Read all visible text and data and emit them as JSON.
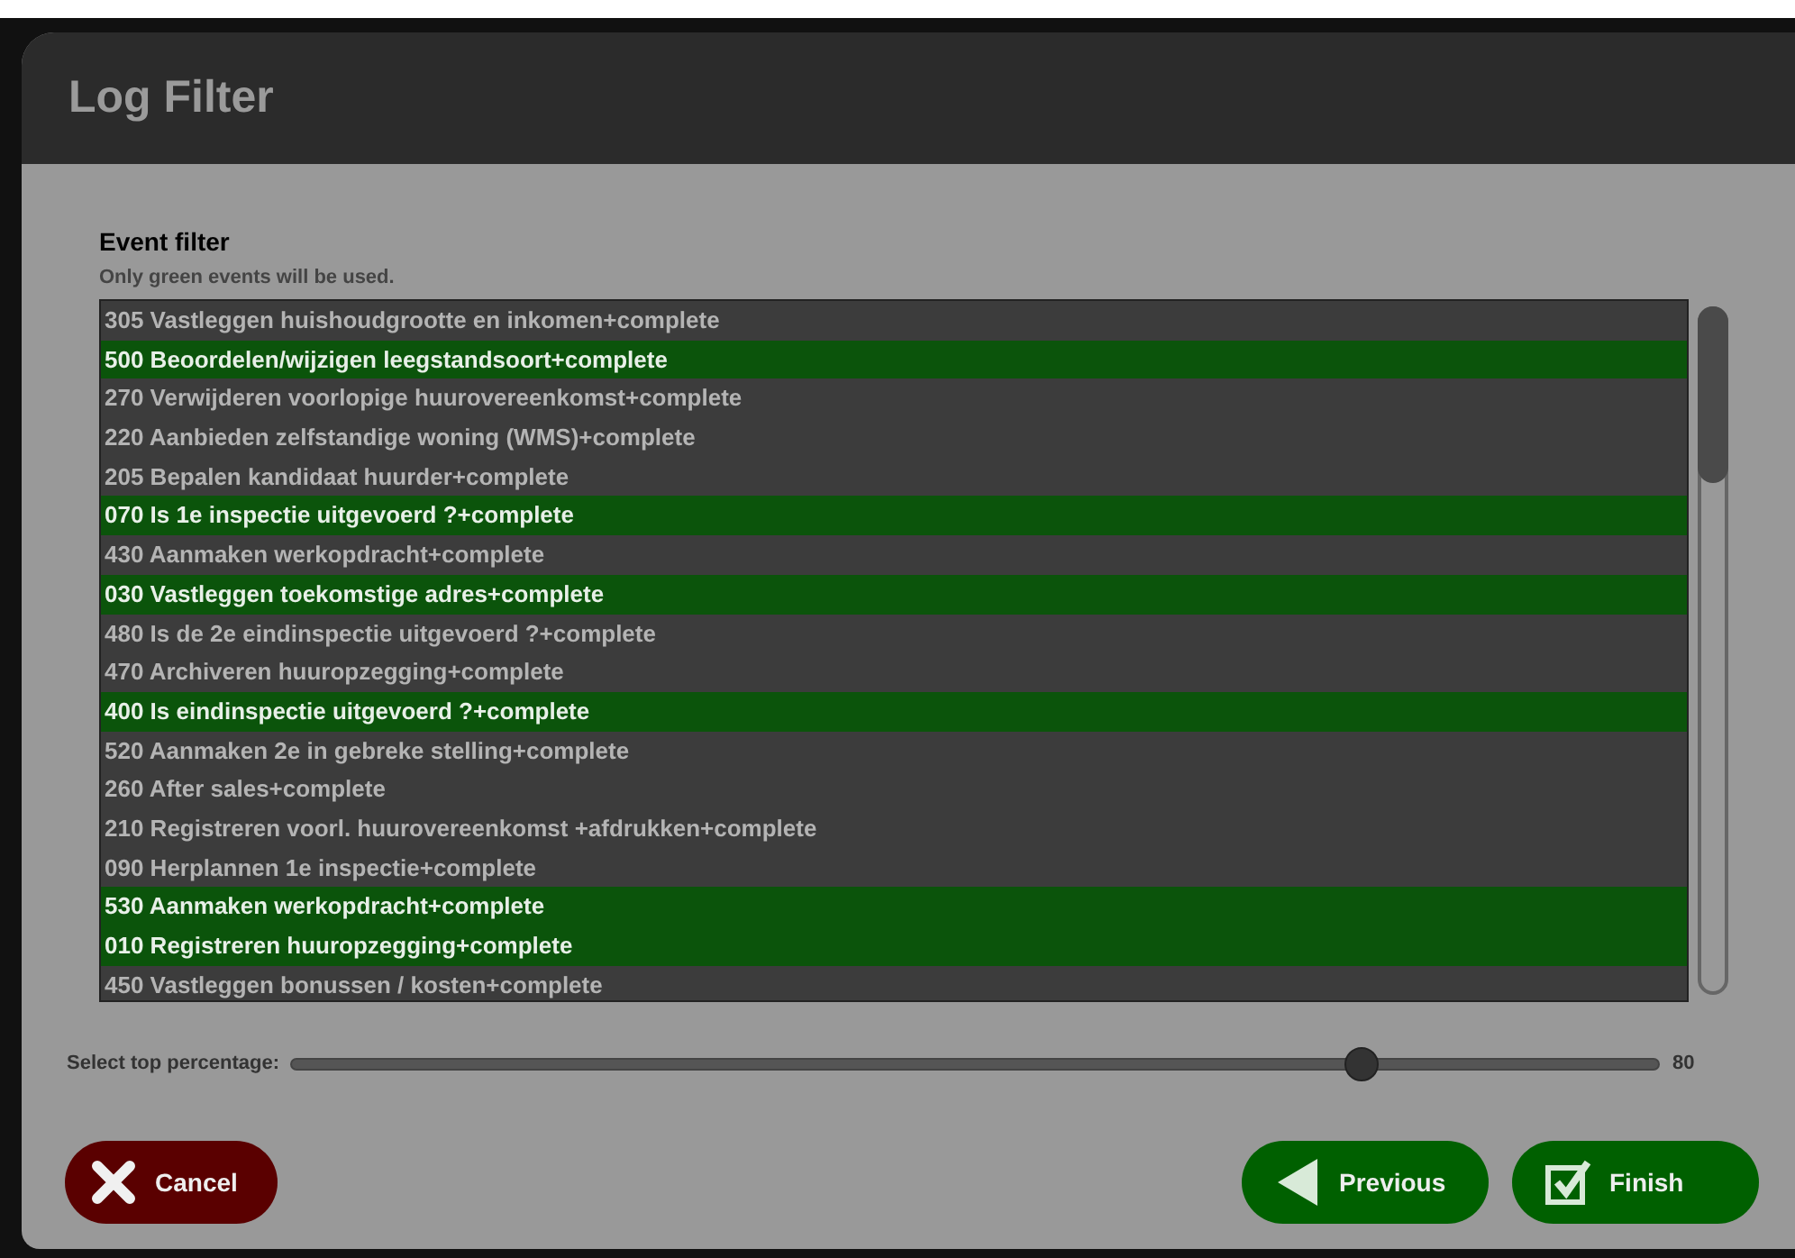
{
  "dialog": {
    "title": "Log Filter"
  },
  "event_filter": {
    "heading": "Event filter",
    "hint": "Only green events will be used.",
    "events": [
      {
        "label": "305 Vastleggen huishoudgrootte en inkomen+complete",
        "used": false
      },
      {
        "label": "500 Beoordelen/wijzigen leegstandsoort+complete",
        "used": true
      },
      {
        "label": "270 Verwijderen voorlopige huurovereenkomst+complete",
        "used": false
      },
      {
        "label": "220 Aanbieden zelfstandige woning (WMS)+complete",
        "used": false
      },
      {
        "label": "205 Bepalen kandidaat huurder+complete",
        "used": false
      },
      {
        "label": "070 Is 1e inspectie uitgevoerd ?+complete",
        "used": true
      },
      {
        "label": "430 Aanmaken werkopdracht+complete",
        "used": false
      },
      {
        "label": "030 Vastleggen toekomstige adres+complete",
        "used": true
      },
      {
        "label": "480 Is de 2e eindinspectie uitgevoerd ?+complete",
        "used": false
      },
      {
        "label": "470 Archiveren huuropzegging+complete",
        "used": false
      },
      {
        "label": "400 Is eindinspectie uitgevoerd ?+complete",
        "used": true
      },
      {
        "label": "520 Aanmaken 2e in gebreke stelling+complete",
        "used": false
      },
      {
        "label": "260 After sales+complete",
        "used": false
      },
      {
        "label": "210 Registreren voorl. huurovereenkomst +afdrukken+complete",
        "used": false
      },
      {
        "label": "090 Herplannen 1e inspectie+complete",
        "used": false
      },
      {
        "label": "530 Aanmaken werkopdracht+complete",
        "used": true
      },
      {
        "label": "010 Registreren huuropzegging+complete",
        "used": true
      },
      {
        "label": "450 Vastleggen bonussen / kosten+complete",
        "used": false
      }
    ]
  },
  "top_percentage": {
    "label": "Select top percentage:",
    "level": 0.79,
    "reading": "80"
  },
  "buttons": [
    {
      "kind": "cancel",
      "label": "Cancel"
    },
    {
      "kind": "previous",
      "label": "Previous"
    },
    {
      "kind": "finish",
      "label": "Finish"
    }
  ]
}
